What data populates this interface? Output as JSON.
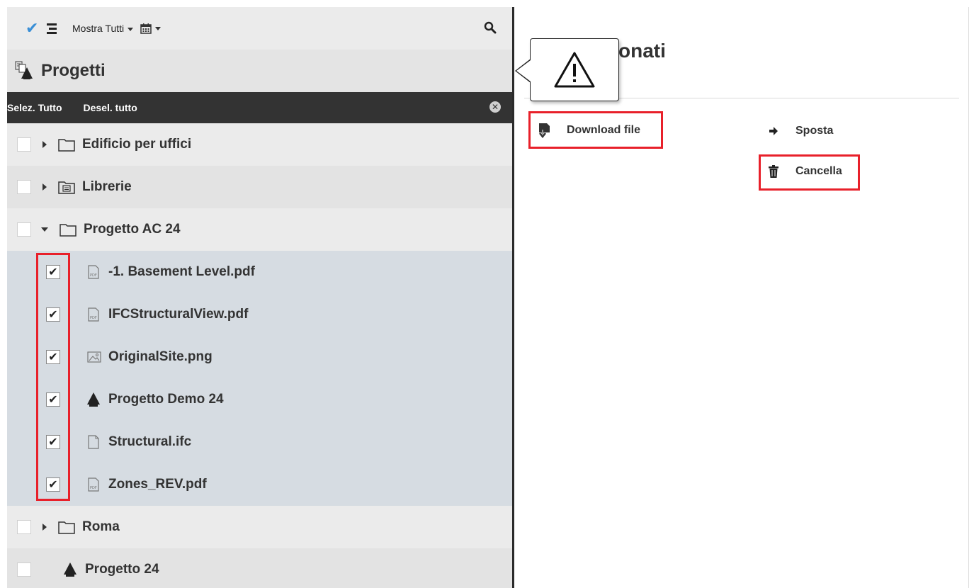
{
  "toolbar": {
    "check_icon": "check-icon",
    "list_icon": "list-icon",
    "show_filter_label": "Mostra Tutti",
    "calendar_icon": "calendar-icon",
    "search_icon": "search-icon"
  },
  "header": {
    "title": "Progetti",
    "icon": "projects-icon"
  },
  "selection_bar": {
    "select_all": "Selez. Tutto",
    "deselect_all": "Desel. tutto",
    "close_icon": "close-circle-icon"
  },
  "tree": {
    "items": [
      {
        "label": "Edificio per uffici",
        "type": "folder",
        "expanded": false,
        "checked": false
      },
      {
        "label": "Librerie",
        "type": "library-folder",
        "expanded": false,
        "checked": false
      },
      {
        "label": "Progetto AC 24",
        "type": "folder",
        "expanded": true,
        "checked": false
      },
      {
        "label": "-1. Basement Level.pdf",
        "type": "pdf",
        "checked": true
      },
      {
        "label": "IFCStructuralView.pdf",
        "type": "pdf",
        "checked": true
      },
      {
        "label": "OriginalSite.png",
        "type": "image",
        "checked": true
      },
      {
        "label": "Progetto Demo 24",
        "type": "project",
        "checked": true
      },
      {
        "label": "Structural.ifc",
        "type": "file",
        "checked": true
      },
      {
        "label": "Zones_REV.pdf",
        "type": "pdf",
        "checked": true
      },
      {
        "label": "Roma",
        "type": "folder",
        "expanded": false,
        "checked": false
      },
      {
        "label": "Progetto 24",
        "type": "project",
        "checked": false
      }
    ]
  },
  "right": {
    "title": "onati",
    "popover_icon": "warning-icon",
    "actions": {
      "download": "Download file",
      "move": "Sposta",
      "delete": "Cancella"
    }
  },
  "colors": {
    "accent": "#3a8fd6",
    "highlight": "#e8202a",
    "dark_bar": "#333333",
    "selected_row": "#d6dce2"
  }
}
